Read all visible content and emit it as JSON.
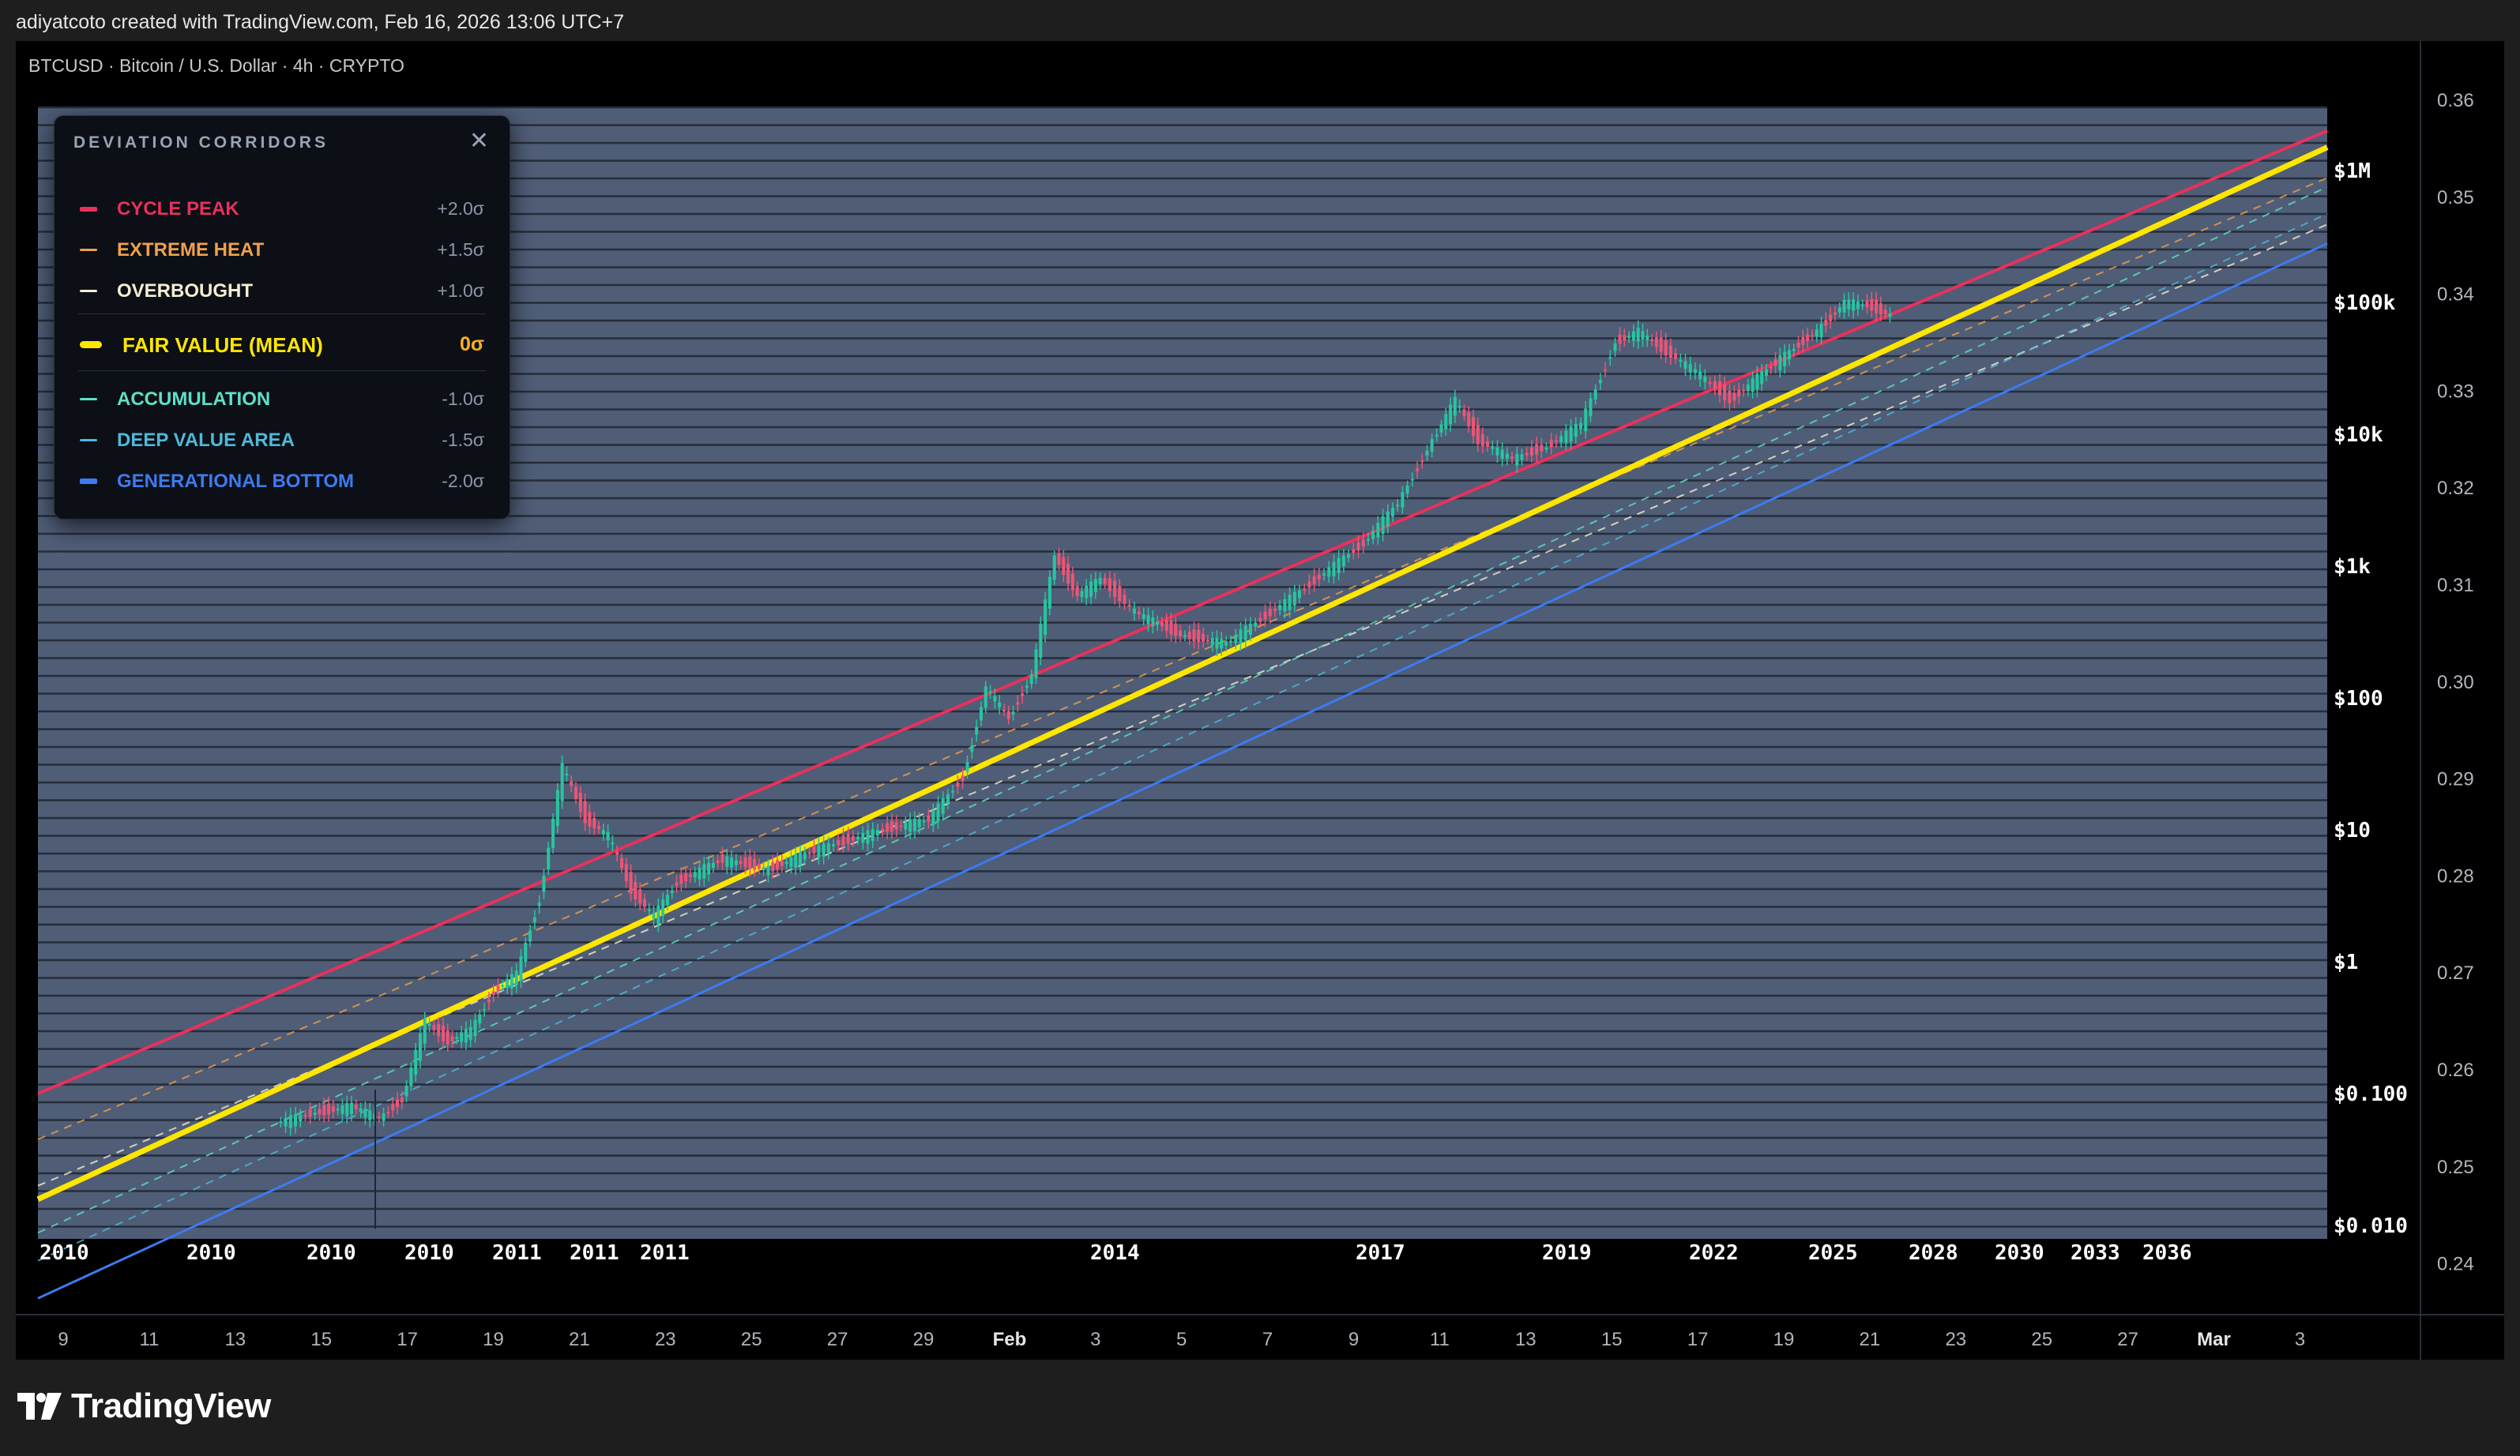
{
  "header": {
    "caption": "adiyatcoto created with TradingView.com, Feb 16, 2026 13:06 UTC+7"
  },
  "symbol": {
    "info": "BTCUSD · Bitcoin / U.S. Dollar · 4h · CRYPTO"
  },
  "legend": {
    "title": "DEVIATION CORRIDORS",
    "close_label": "✕",
    "rows": [
      {
        "label": "CYCLE PEAK",
        "value": "+2.0σ",
        "color": "#e8315b"
      },
      {
        "label": "EXTREME HEAT",
        "value": "+1.5σ",
        "color": "#f0a04b"
      },
      {
        "label": "OVERBOUGHT",
        "value": "+1.0σ",
        "color": "#f5eed0"
      },
      {
        "label": "FAIR VALUE (MEAN)",
        "value": "0σ",
        "color": "#ffe600"
      },
      {
        "label": "ACCUMULATION",
        "value": "-1.0σ",
        "color": "#5fe0c6"
      },
      {
        "label": "DEEP VALUE AREA",
        "value": "-1.5σ",
        "color": "#4fb9d8"
      },
      {
        "label": "GENERATIONAL BOTTOM",
        "value": "-2.0σ",
        "color": "#3d7bf0"
      }
    ]
  },
  "branding": {
    "name": "TradingView",
    "icon": "tradingview-logo-icon"
  },
  "colors": {
    "panel_bg": "#4f5d77",
    "up_candle": "#26c6a0",
    "down_candle": "#ef5375",
    "mean_line": "#ffe600"
  },
  "chart_data": {
    "type": "line",
    "title": "",
    "x_axis_years": [
      "2010",
      "2010",
      "2010",
      "2010",
      "2011",
      "2011",
      "2011",
      "2014",
      "2017",
      "2019",
      "2022",
      "2025",
      "2028",
      "2030",
      "2033",
      "2036"
    ],
    "x_axis_time_ticks": [
      "9",
      "11",
      "13",
      "15",
      "17",
      "19",
      "21",
      "23",
      "25",
      "27",
      "29",
      "Feb",
      "3",
      "5",
      "7",
      "9",
      "11",
      "13",
      "15",
      "17",
      "19",
      "21",
      "23",
      "25",
      "27",
      "Mar",
      "3"
    ],
    "y_axis_price_labels": [
      "$1M",
      "$100k",
      "$10k",
      "$1k",
      "$100",
      "$10",
      "$1",
      "$0.100",
      "$0.010"
    ],
    "y_axis_price_values": [
      1000000,
      100000,
      10000,
      1000,
      100,
      10,
      1,
      0.1,
      0.01
    ],
    "y_scale": "log",
    "right_axis_labels": [
      "0.36",
      "0.35",
      "0.34",
      "0.33",
      "0.32",
      "0.31",
      "0.30",
      "0.29",
      "0.28",
      "0.27",
      "0.26",
      "0.25",
      "0.24"
    ],
    "right_axis_values": [
      0.36,
      0.35,
      0.34,
      0.33,
      0.32,
      0.31,
      0.3,
      0.29,
      0.28,
      0.27,
      0.26,
      0.25,
      0.24
    ],
    "corridors": [
      {
        "name": "CYCLE PEAK",
        "sigma": 2.0,
        "color": "#e8315b",
        "start_price": 0.1,
        "end_price": 2000000
      },
      {
        "name": "EXTREME HEAT",
        "sigma": 1.5,
        "color": "#f0a04b",
        "start_price": 0.045,
        "end_price": 880000
      },
      {
        "name": "OVERBOUGHT",
        "sigma": 1.0,
        "color": "#f5eed0",
        "start_price": 0.02,
        "end_price": 390000
      },
      {
        "name": "FAIR VALUE (MEAN)",
        "sigma": 0.0,
        "color": "#ffe600",
        "start_price": 0.0158,
        "end_price": 1500000
      },
      {
        "name": "ACCUMULATION",
        "sigma": -1.0,
        "color": "#5fe0c6",
        "start_price": 0.0088,
        "end_price": 750000
      },
      {
        "name": "DEEP VALUE AREA",
        "sigma": -1.5,
        "color": "#4fb9d8",
        "start_price": 0.0054,
        "end_price": 470000
      },
      {
        "name": "GENERATIONAL BOTTOM",
        "sigma": -2.0,
        "color": "#3d7bf0",
        "start_price": 0.0028,
        "end_price": 280000
      }
    ],
    "price_path": [
      [
        0.105,
        0.06
      ],
      [
        0.12,
        0.07
      ],
      [
        0.138,
        0.08
      ],
      [
        0.15,
        0.065
      ],
      [
        0.16,
        0.09
      ],
      [
        0.17,
        0.35
      ],
      [
        0.18,
        0.25
      ],
      [
        0.19,
        0.3
      ],
      [
        0.2,
        0.6
      ],
      [
        0.21,
        0.8
      ],
      [
        0.22,
        3
      ],
      [
        0.23,
        30
      ],
      [
        0.24,
        12
      ],
      [
        0.25,
        9
      ],
      [
        0.26,
        3.5
      ],
      [
        0.27,
        2.2
      ],
      [
        0.28,
        4
      ],
      [
        0.3,
        6
      ],
      [
        0.32,
        5
      ],
      [
        0.34,
        7
      ],
      [
        0.37,
        10
      ],
      [
        0.39,
        12
      ],
      [
        0.405,
        25
      ],
      [
        0.415,
        120
      ],
      [
        0.425,
        70
      ],
      [
        0.435,
        150
      ],
      [
        0.445,
        1200
      ],
      [
        0.455,
        600
      ],
      [
        0.465,
        800
      ],
      [
        0.48,
        450
      ],
      [
        0.5,
        300
      ],
      [
        0.52,
        260
      ],
      [
        0.55,
        600
      ],
      [
        0.58,
        1500
      ],
      [
        0.595,
        3000
      ],
      [
        0.61,
        9000
      ],
      [
        0.62,
        18000
      ],
      [
        0.63,
        9000
      ],
      [
        0.645,
        6500
      ],
      [
        0.66,
        8000
      ],
      [
        0.675,
        12000
      ],
      [
        0.69,
        50000
      ],
      [
        0.7,
        60000
      ],
      [
        0.71,
        45000
      ],
      [
        0.725,
        30000
      ],
      [
        0.74,
        18000
      ],
      [
        0.76,
        35000
      ],
      [
        0.78,
        65000
      ],
      [
        0.79,
        100000
      ],
      [
        0.8,
        95000
      ],
      [
        0.81,
        80000
      ]
    ]
  }
}
